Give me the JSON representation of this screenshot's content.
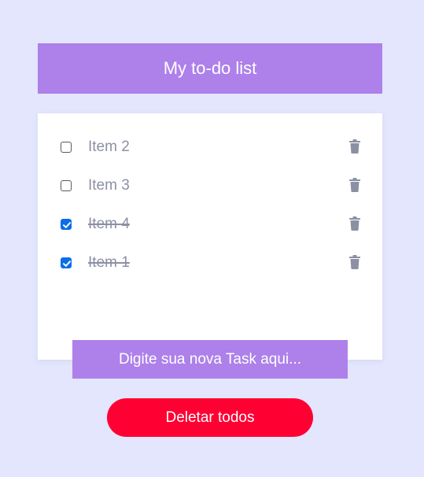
{
  "header": {
    "title": "My to-do list"
  },
  "todos": [
    {
      "label": "Item 2",
      "done": false
    },
    {
      "label": "Item 3",
      "done": false
    },
    {
      "label": "Item 4",
      "done": true
    },
    {
      "label": "Item 1",
      "done": true
    }
  ],
  "new_task": {
    "placeholder": "Digite sua nova Task aqui..."
  },
  "actions": {
    "delete_all_label": "Deletar todos"
  },
  "icons": {
    "item_delete": "trash-icon",
    "checkmark": "checkmark-icon"
  },
  "colors": {
    "background": "#e3e6fd",
    "accent": "#ad80ea",
    "danger": "#ff0033",
    "checkbox_checked": "#0a6ee8",
    "item_text": "#8c90a3",
    "trash_icon": "#8c90a3"
  }
}
